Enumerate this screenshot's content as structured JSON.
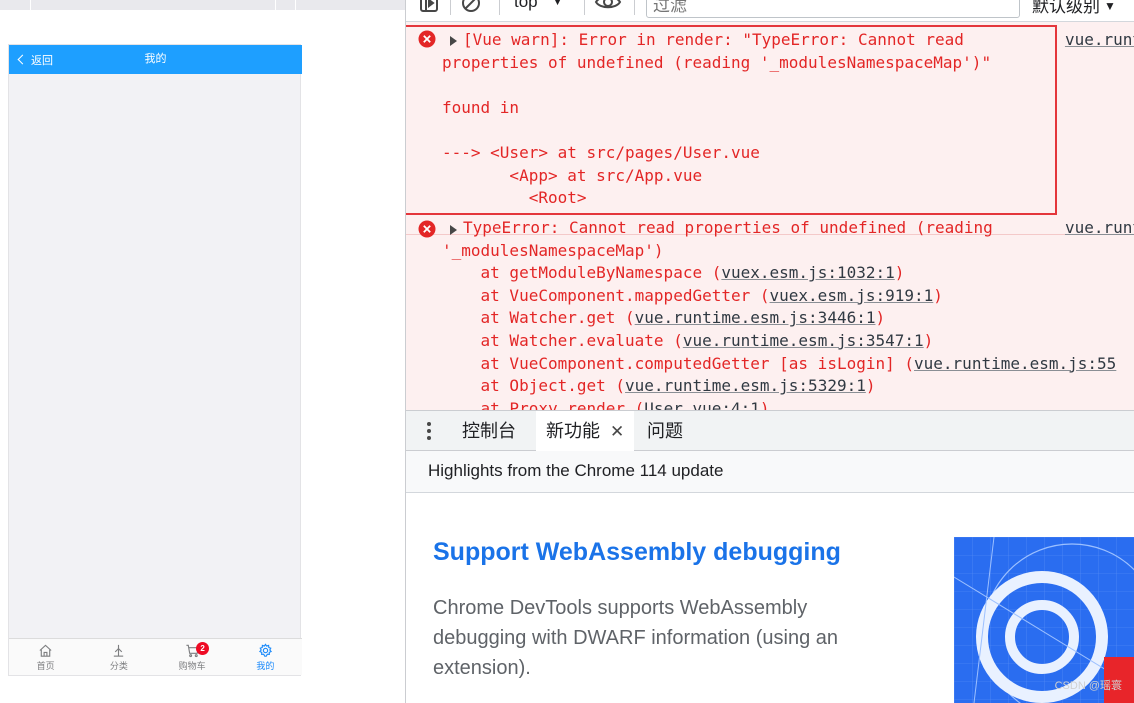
{
  "phone": {
    "back_label": "返回",
    "title": "我的",
    "tabs": [
      {
        "label": "首页",
        "icon": "home-icon"
      },
      {
        "label": "分类",
        "icon": "category-icon"
      },
      {
        "label": "购物车",
        "icon": "cart-icon",
        "badge": "2"
      },
      {
        "label": "我的",
        "icon": "gear-icon",
        "active": true
      }
    ],
    "header_color": "#1e9fff"
  },
  "toolbar": {
    "context": "top",
    "filter_placeholder": "过滤",
    "levels_label": "默认级别"
  },
  "console": {
    "messages": [
      {
        "level": "error",
        "source": "vue.runt",
        "lines": [
          "[Vue warn]: Error in render: \"TypeError: Cannot read",
          "properties of undefined (reading '_modulesNamespaceMap')\"",
          "",
          "found in",
          "",
          "---> <User> at src/pages/User.vue",
          "       <App> at src/App.vue",
          "         <Root>"
        ]
      },
      {
        "level": "error",
        "source": "vue.runt",
        "lines": [
          "TypeError: Cannot read properties of undefined (reading",
          "'_modulesNamespaceMap')"
        ],
        "stack": [
          {
            "prefix": "    at getModuleByNamespace (",
            "link": "vuex.esm.js:1032:1",
            "suffix": ")"
          },
          {
            "prefix": "    at VueComponent.mappedGetter (",
            "link": "vuex.esm.js:919:1",
            "suffix": ")"
          },
          {
            "prefix": "    at Watcher.get (",
            "link": "vue.runtime.esm.js:3446:1",
            "suffix": ")"
          },
          {
            "prefix": "    at Watcher.evaluate (",
            "link": "vue.runtime.esm.js:3547:1",
            "suffix": ")"
          },
          {
            "prefix": "    at VueComponent.computedGetter [as isLogin] (",
            "link": "vue.runtime.esm.js:55",
            "suffix": ""
          },
          {
            "prefix": "    at Object.get (",
            "link": "vue.runtime.esm.js:5329:1",
            "suffix": ")"
          },
          {
            "prefix": "    at Proxy.render (",
            "link": "User.vue:4:1",
            "suffix": ")"
          }
        ]
      }
    ]
  },
  "drawer": {
    "tabs": [
      {
        "label": "控制台"
      },
      {
        "label": "新功能",
        "active": true,
        "closable": true
      },
      {
        "label": "问题"
      }
    ]
  },
  "whats_new": {
    "header": "Highlights from the Chrome 114 update",
    "title": "Support WebAssembly debugging",
    "body": "Chrome DevTools supports WebAssembly debugging with DWARF information (using an extension).",
    "watermark": "CSDN @瑶寰"
  },
  "colors": {
    "error_text": "#e32626",
    "error_bg": "#fdf0f0",
    "highlight_border": "#e4363b",
    "link_blue": "#1a73e8",
    "active_tab": "#1989fa"
  }
}
